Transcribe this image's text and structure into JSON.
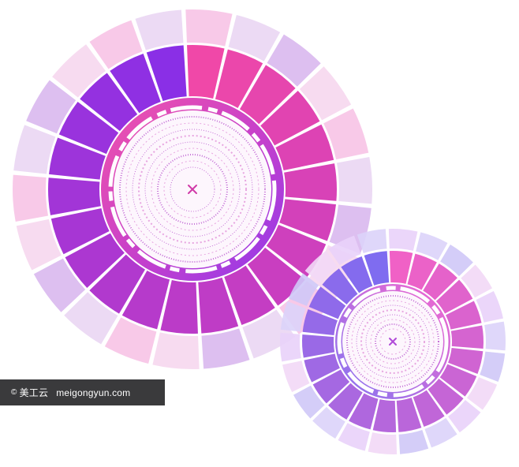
{
  "watermark": {
    "symbol": "©",
    "brand": "美工云",
    "site": "meigongyun.com"
  },
  "graphics": [
    {
      "name": "large-radial-dial",
      "palette": {
        "outer": [
          "#f7c3e6",
          "#ead6f3",
          "#d9b8ee",
          "#f6d7ee"
        ],
        "inner_start": "#f048a8",
        "inner_end": "#8a2fe6",
        "core": "#ffffff",
        "center_mark": "#d03aa8"
      }
    },
    {
      "name": "small-radial-dial",
      "palette": {
        "outer": [
          "#e9d2fa",
          "#dcd3fa",
          "#cfc8f7",
          "#f2d8f6"
        ],
        "inner_start": "#f061c6",
        "inner_end": "#7f6cf0",
        "core": "#ffffff",
        "center_mark": "#b04bd8"
      }
    }
  ]
}
